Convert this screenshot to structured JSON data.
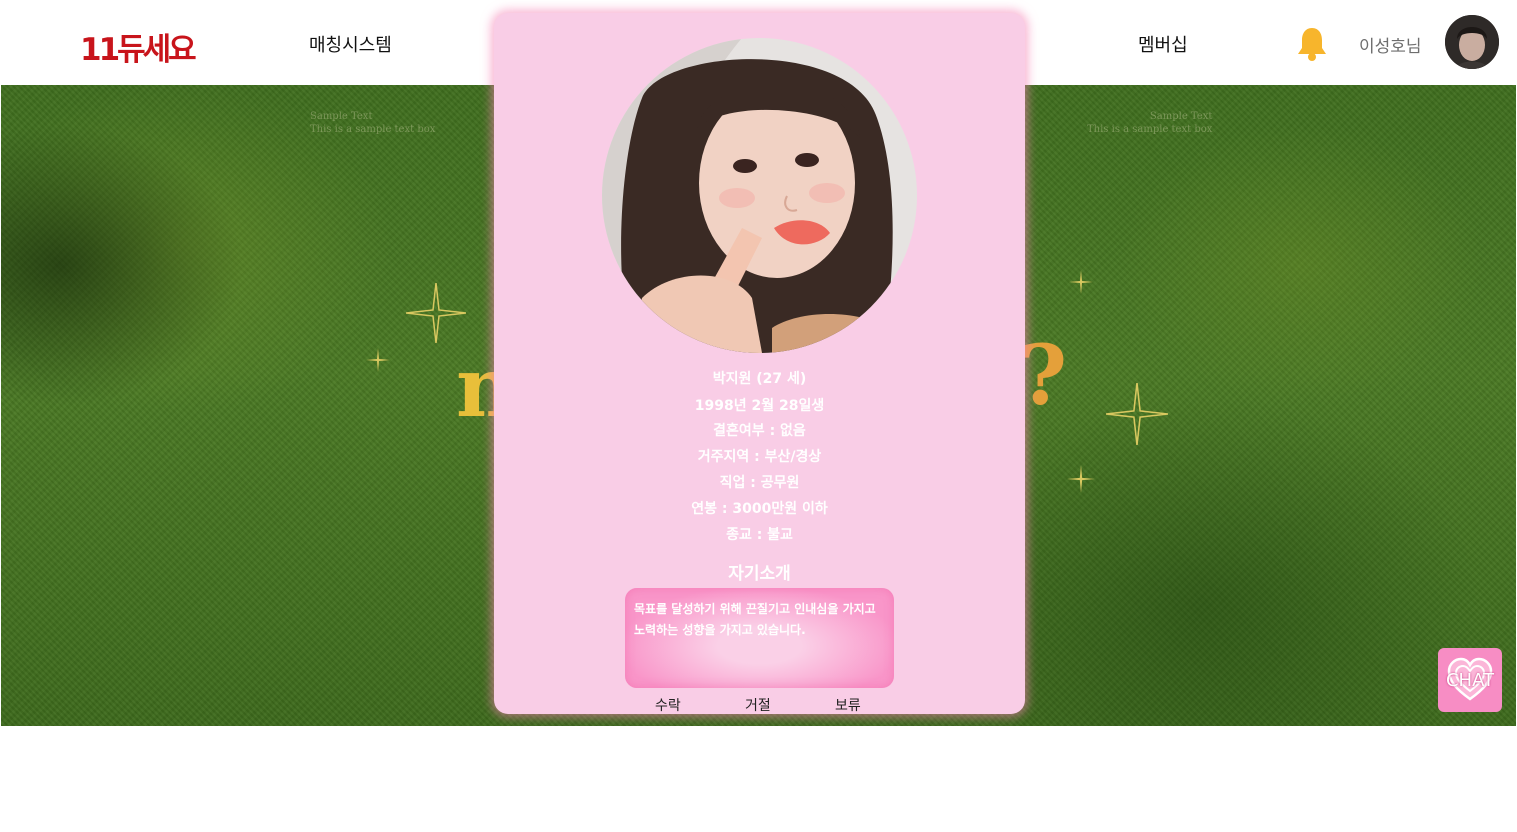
{
  "header": {
    "logo": "11듀세요",
    "nav": {
      "matching": "매칭시스템",
      "membership": "멤버십"
    },
    "user_name": "이성호님"
  },
  "hero": {
    "sample_text_line1": "Sample Text",
    "sample_text_line2": "This is a sample text box",
    "big_text_left": "n",
    "big_text_right": "?"
  },
  "profile": {
    "name_age": "박지원 (27 세)",
    "birth": "1998년 2월 28일생",
    "marriage": "결혼여부 : 없음",
    "region": "거주지역 : 부산/경상",
    "job": "직업 : 공무원",
    "salary": "연봉 : 3000만원 이하",
    "religion": "종교 : 불교",
    "intro_title": "자기소개",
    "intro_text": "목표를 달성하기 위해 끈질기고 인내심을 가지고 노력하는 성향을 가지고 있습니다."
  },
  "actions": {
    "accept": "수락",
    "reject": "거절",
    "hold": "보류"
  },
  "chat": {
    "label": "CHAT"
  },
  "icons": {
    "bell": "bell-icon",
    "chat": "heart-icon"
  },
  "colors": {
    "brand": "#c8141b",
    "card_bg": "#f9cde6",
    "chat_bg": "#f78dc4",
    "bell": "#f7b52c"
  }
}
